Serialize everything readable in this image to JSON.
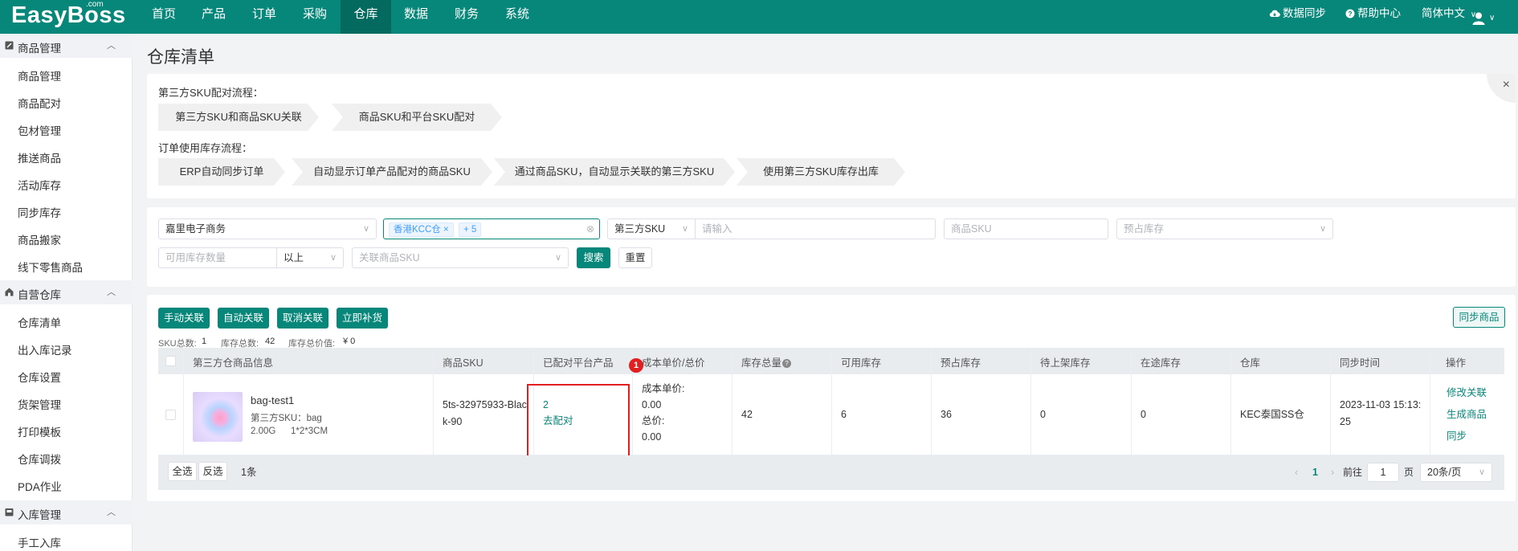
{
  "app": {
    "logo": "EasyBoss",
    "logo_suffix": ".com"
  },
  "nav": {
    "items": [
      "首页",
      "产品",
      "订单",
      "采购",
      "仓库",
      "数据",
      "财务",
      "系统"
    ],
    "active_index": 4
  },
  "topright": {
    "sync": "数据同步",
    "help": "帮助中心",
    "lang": "简体中文"
  },
  "sidebar": {
    "groups": [
      {
        "label": "商品管理",
        "items": [
          "商品管理",
          "商品配对",
          "包材管理",
          "推送商品",
          "活动库存",
          "同步库存",
          "商品搬家",
          "线下零售商品"
        ]
      },
      {
        "label": "自营仓库",
        "items": [
          "仓库清单",
          "出入库记录",
          "仓库设置",
          "货架管理",
          "打印模板",
          "仓库调拨",
          "PDA作业"
        ]
      },
      {
        "label": "入库管理",
        "items": [
          "手工入库"
        ]
      }
    ]
  },
  "page": {
    "title": "仓库清单"
  },
  "flow": {
    "sku_label": "第三方SKU配对流程：",
    "sku_steps": [
      "第三方SKU和商品SKU关联",
      "商品SKU和平台SKU配对"
    ],
    "order_label": "订单使用库存流程：",
    "order_steps": [
      "ERP自动同步订单",
      "自动显示订单产品配对的商品SKU",
      "通过商品SKU，自动显示关联的第三方SKU",
      "使用第三方SKU库存出库"
    ]
  },
  "filters": {
    "company": "嘉里电子商务",
    "warehouse_tag": "香港KCC仓",
    "warehouse_more": "+ 5",
    "sku_type": "第三方SKU",
    "sku_input_placeholder": "请输入",
    "product_sku_placeholder": "商品SKU",
    "reserved_placeholder": "预占库存",
    "available_qty_placeholder": "可用库存数量",
    "compare": "以上",
    "linked_sku_placeholder": "关联商品SKU",
    "search": "搜索",
    "reset": "重置"
  },
  "actions": {
    "manual_link": "手动关联",
    "auto_link": "自动关联",
    "cancel_link": "取消关联",
    "restock": "立即补货",
    "sync_products": "同步商品"
  },
  "summary": {
    "sku_total_label": "SKU总数:",
    "sku_total": "1",
    "stock_total_label": "库存总数:",
    "stock_total": "42",
    "stock_value_label": "库存总价值:",
    "stock_value": "¥ 0"
  },
  "table": {
    "headers": [
      "第三方仓商品信息",
      "商品SKU",
      "已配对平台产品",
      "成本单价/总价",
      "库存总量",
      "可用库存",
      "预占库存",
      "待上架库存",
      "在途库存",
      "仓库",
      "同步时间",
      "操作"
    ],
    "badge": "1",
    "row": {
      "name": "bag-test1",
      "third_sku": "第三方SKU：bag",
      "spec_weight": "2.00G",
      "spec_size": "1*2*3CM",
      "product_sku": "5ts-32975933-Black-90",
      "paired_count": "2",
      "pair_link": "去配对",
      "cost_unit_label": "成本单价:",
      "cost_unit": "0.00",
      "cost_total_label": "总价:",
      "cost_total": "0.00",
      "stock_total": "42",
      "available": "6",
      "reserved": "36",
      "pending": "0",
      "in_transit": "0",
      "warehouse": "KEC泰国SS仓",
      "sync_time": "2023-11-03 15:13:25",
      "ops": [
        "修改关联",
        "生成商品",
        "同步"
      ]
    }
  },
  "footer": {
    "select_all": "全选",
    "invert": "反选",
    "count": "1条",
    "page": "1",
    "goto_label": "前往",
    "goto_value": "1",
    "page_unit": "页",
    "page_size": "20条/页"
  },
  "colors": {
    "brand": "#07877a",
    "highlight_box": "#e02020",
    "badge": "#e02020"
  }
}
